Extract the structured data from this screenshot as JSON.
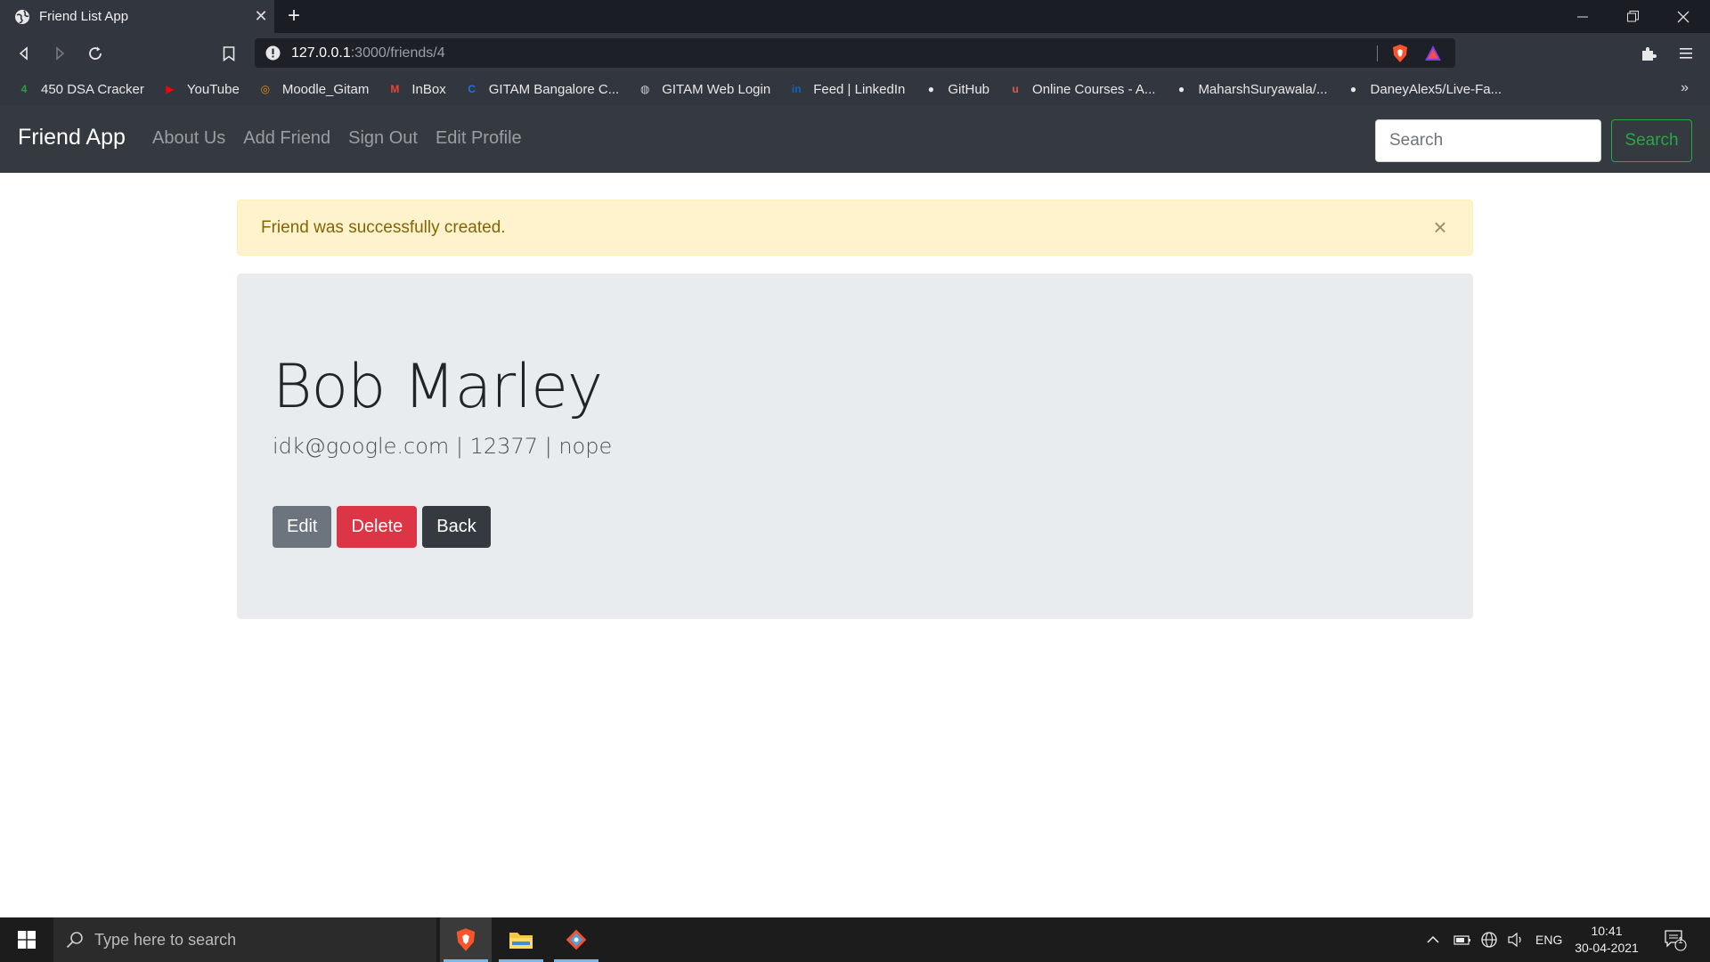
{
  "browser": {
    "tab_title": "Friend List App",
    "new_tab_symbol": "+",
    "url_host": "127.0.0.1",
    "url_path": ":3000/friends/4",
    "bookmarks": [
      {
        "label": "450 DSA Cracker",
        "icon": "dsa-icon",
        "color": "#2e9e3e",
        "glyph": "4"
      },
      {
        "label": "YouTube",
        "icon": "youtube-icon",
        "color": "#ff0000",
        "glyph": "▶"
      },
      {
        "label": "Moodle_Gitam",
        "icon": "moodle-icon",
        "color": "#e08a1e",
        "glyph": "◎"
      },
      {
        "label": "InBox",
        "icon": "gmail-icon",
        "color": "#ea4335",
        "glyph": "M"
      },
      {
        "label": "GITAM Bangalore C...",
        "icon": "gitam-c-icon",
        "color": "#1a73e8",
        "glyph": "C"
      },
      {
        "label": "GITAM Web Login",
        "icon": "globe-icon",
        "color": "#cfcfcf",
        "glyph": "◍"
      },
      {
        "label": "Feed | LinkedIn",
        "icon": "linkedin-icon",
        "color": "#0a66c2",
        "glyph": "in"
      },
      {
        "label": "GitHub",
        "icon": "github-icon",
        "color": "#e8e8e8",
        "glyph": "●"
      },
      {
        "label": "Online Courses - A...",
        "icon": "udemy-icon",
        "color": "#ec5252",
        "glyph": "u"
      },
      {
        "label": "MaharshSuryawala/...",
        "icon": "github-icon",
        "color": "#e8e8e8",
        "glyph": "●"
      },
      {
        "label": "DaneyAlex5/Live-Fa...",
        "icon": "github-icon",
        "color": "#e8e8e8",
        "glyph": "●"
      }
    ],
    "bookmarks_more": "»"
  },
  "navbar": {
    "brand": "Friend App",
    "links": [
      "About Us",
      "Add Friend",
      "Sign Out",
      "Edit Profile"
    ],
    "search_placeholder": "Search",
    "search_button": "Search"
  },
  "alert": {
    "message": "Friend was successfully created.",
    "close": "×"
  },
  "friend": {
    "name": "Bob Marley",
    "details": "idk@google.com | 12377 | nope",
    "edit_label": "Edit",
    "delete_label": "Delete",
    "back_label": "Back"
  },
  "taskbar": {
    "search_placeholder": "Type here to search",
    "language": "ENG",
    "time": "10:41",
    "date": "30-04-2021",
    "notification_count": "1"
  },
  "colors": {
    "navbar_bg": "#343a40",
    "alert_bg": "#fff3cd",
    "alert_text": "#856404",
    "jumbotron_bg": "#e9ecef",
    "success": "#28a745",
    "danger": "#dc3545",
    "secondary": "#6c757d",
    "dark": "#343a40"
  }
}
